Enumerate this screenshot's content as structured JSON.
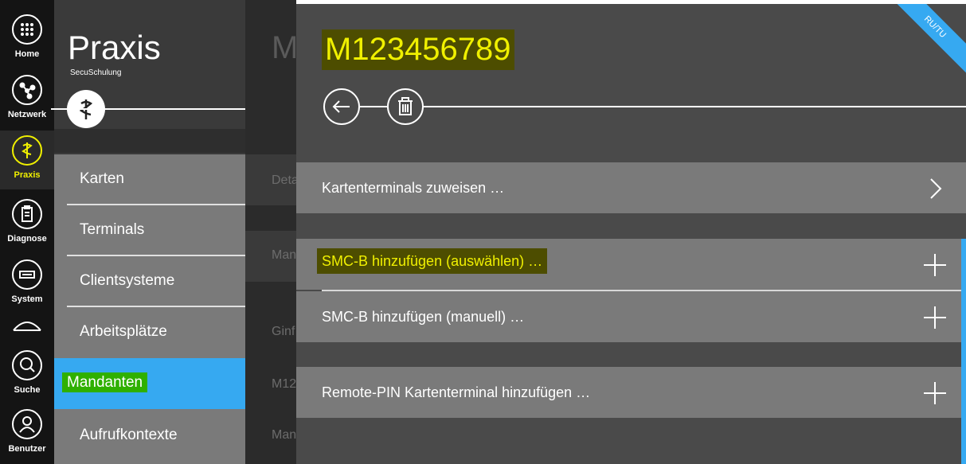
{
  "rail": {
    "items": [
      {
        "label": "Home",
        "icon": "grid-icon"
      },
      {
        "label": "Netzwerk",
        "icon": "network-icon"
      },
      {
        "label": "Praxis",
        "icon": "caduceus-icon"
      },
      {
        "label": "Diagnose",
        "icon": "clipboard-icon"
      },
      {
        "label": "System",
        "icon": "keyboard-icon"
      },
      {
        "label": "Suche",
        "icon": "search-icon"
      },
      {
        "label": "Benutzer",
        "icon": "user-icon"
      }
    ]
  },
  "panel": {
    "title": "Praxis",
    "subtitle": "SecuSchulung",
    "nav": [
      {
        "label": "Karten"
      },
      {
        "label": "Terminals"
      },
      {
        "label": "Clientsysteme"
      },
      {
        "label": "Arbeitsplätze"
      },
      {
        "label": "Mandanten"
      },
      {
        "label": "Aufrufkontexte"
      }
    ]
  },
  "ghost": {
    "title": "M",
    "items": [
      "Deta",
      "Man",
      "Ginf",
      "M12",
      "Man"
    ]
  },
  "main": {
    "title": "M123456789",
    "ribbon": "RU/TU",
    "rows": {
      "assign_terminals": "Kartenterminals zuweisen …",
      "smcb_select": "SMC-B hinzufügen (auswählen) …",
      "smcb_manual": "SMC-B hinzufügen (manuell) …",
      "remote_pin": "Remote-PIN Kartenterminal hinzufügen …"
    }
  },
  "colors": {
    "accent": "#36a9f1",
    "highlight_yellow": "#f0f000",
    "highlight_green": "#2fb000"
  }
}
